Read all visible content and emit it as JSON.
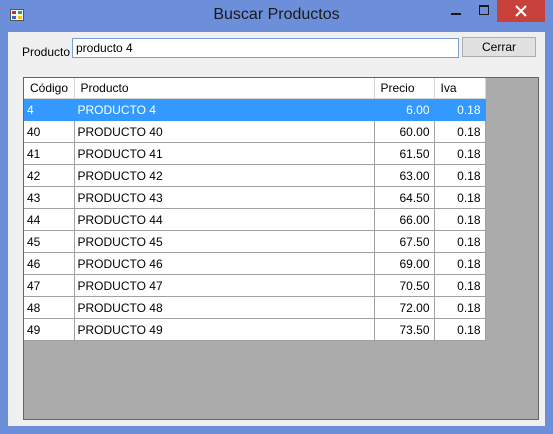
{
  "window": {
    "title": "Buscar Productos",
    "close_color": "#c7403a",
    "frame_color": "#6d8fd9"
  },
  "search": {
    "label": "Producto :",
    "value": "producto 4",
    "button_label": "Cerrar"
  },
  "grid": {
    "columns": [
      "Código",
      "Producto",
      "Precio",
      "Iva"
    ],
    "selection_color": "#3399ff",
    "selected_index": 0,
    "rows": [
      {
        "codigo": "4",
        "producto": "PRODUCTO 4",
        "precio": "6.00",
        "iva": "0.18"
      },
      {
        "codigo": "40",
        "producto": "PRODUCTO 40",
        "precio": "60.00",
        "iva": "0.18"
      },
      {
        "codigo": "41",
        "producto": "PRODUCTO 41",
        "precio": "61.50",
        "iva": "0.18"
      },
      {
        "codigo": "42",
        "producto": "PRODUCTO 42",
        "precio": "63.00",
        "iva": "0.18"
      },
      {
        "codigo": "43",
        "producto": "PRODUCTO 43",
        "precio": "64.50",
        "iva": "0.18"
      },
      {
        "codigo": "44",
        "producto": "PRODUCTO 44",
        "precio": "66.00",
        "iva": "0.18"
      },
      {
        "codigo": "45",
        "producto": "PRODUCTO 45",
        "precio": "67.50",
        "iva": "0.18"
      },
      {
        "codigo": "46",
        "producto": "PRODUCTO 46",
        "precio": "69.00",
        "iva": "0.18"
      },
      {
        "codigo": "47",
        "producto": "PRODUCTO 47",
        "precio": "70.50",
        "iva": "0.18"
      },
      {
        "codigo": "48",
        "producto": "PRODUCTO 48",
        "precio": "72.00",
        "iva": "0.18"
      },
      {
        "codigo": "49",
        "producto": "PRODUCTO 49",
        "precio": "73.50",
        "iva": "0.18"
      }
    ]
  }
}
